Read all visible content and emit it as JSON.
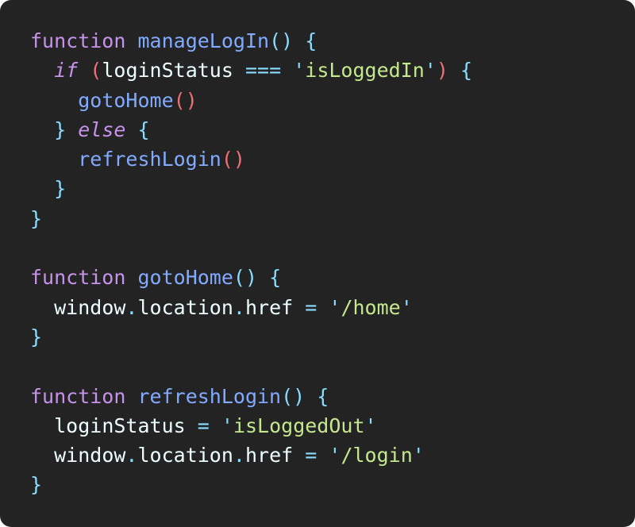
{
  "code_editor": {
    "lines": [
      [
        {
          "t": "function",
          "c": "kw"
        },
        {
          "t": " ",
          "c": "id"
        },
        {
          "t": "manageLogIn",
          "c": "fn"
        },
        {
          "t": "()",
          "c": "br"
        },
        {
          "t": " ",
          "c": "id"
        },
        {
          "t": "{",
          "c": "br"
        }
      ],
      [
        {
          "t": "  ",
          "c": "id"
        },
        {
          "t": "if",
          "c": "kw ital"
        },
        {
          "t": " ",
          "c": "id"
        },
        {
          "t": "(",
          "c": "pr"
        },
        {
          "t": "loginStatus",
          "c": "id"
        },
        {
          "t": " ",
          "c": "id"
        },
        {
          "t": "===",
          "c": "op"
        },
        {
          "t": " ",
          "c": "id"
        },
        {
          "t": "'",
          "c": "br"
        },
        {
          "t": "isLoggedIn",
          "c": "str"
        },
        {
          "t": "'",
          "c": "br"
        },
        {
          "t": ")",
          "c": "pr"
        },
        {
          "t": " ",
          "c": "id"
        },
        {
          "t": "{",
          "c": "br"
        }
      ],
      [
        {
          "t": "    ",
          "c": "id"
        },
        {
          "t": "gotoHome",
          "c": "fn"
        },
        {
          "t": "()",
          "c": "pr"
        }
      ],
      [
        {
          "t": "  ",
          "c": "id"
        },
        {
          "t": "}",
          "c": "br"
        },
        {
          "t": " ",
          "c": "id"
        },
        {
          "t": "else",
          "c": "kw ital"
        },
        {
          "t": " ",
          "c": "id"
        },
        {
          "t": "{",
          "c": "br"
        }
      ],
      [
        {
          "t": "    ",
          "c": "id"
        },
        {
          "t": "refreshLogin",
          "c": "fn"
        },
        {
          "t": "()",
          "c": "pr"
        }
      ],
      [
        {
          "t": "  ",
          "c": "id"
        },
        {
          "t": "}",
          "c": "br"
        }
      ],
      [
        {
          "t": "}",
          "c": "br"
        }
      ],
      [],
      [
        {
          "t": "function",
          "c": "kw"
        },
        {
          "t": " ",
          "c": "id"
        },
        {
          "t": "gotoHome",
          "c": "fn"
        },
        {
          "t": "()",
          "c": "br"
        },
        {
          "t": " ",
          "c": "id"
        },
        {
          "t": "{",
          "c": "br"
        }
      ],
      [
        {
          "t": "  ",
          "c": "id"
        },
        {
          "t": "window",
          "c": "id"
        },
        {
          "t": ".",
          "c": "op"
        },
        {
          "t": "location",
          "c": "id"
        },
        {
          "t": ".",
          "c": "op"
        },
        {
          "t": "href",
          "c": "id"
        },
        {
          "t": " ",
          "c": "id"
        },
        {
          "t": "=",
          "c": "op"
        },
        {
          "t": " ",
          "c": "id"
        },
        {
          "t": "'",
          "c": "br"
        },
        {
          "t": "/home",
          "c": "str"
        },
        {
          "t": "'",
          "c": "br"
        }
      ],
      [
        {
          "t": "}",
          "c": "br"
        }
      ],
      [],
      [
        {
          "t": "function",
          "c": "kw"
        },
        {
          "t": " ",
          "c": "id"
        },
        {
          "t": "refreshLogin",
          "c": "fn"
        },
        {
          "t": "()",
          "c": "br"
        },
        {
          "t": " ",
          "c": "id"
        },
        {
          "t": "{",
          "c": "br"
        }
      ],
      [
        {
          "t": "  ",
          "c": "id"
        },
        {
          "t": "loginStatus",
          "c": "id"
        },
        {
          "t": " ",
          "c": "id"
        },
        {
          "t": "=",
          "c": "op"
        },
        {
          "t": " ",
          "c": "id"
        },
        {
          "t": "'",
          "c": "br"
        },
        {
          "t": "isLoggedOut",
          "c": "str"
        },
        {
          "t": "'",
          "c": "br"
        }
      ],
      [
        {
          "t": "  ",
          "c": "id"
        },
        {
          "t": "window",
          "c": "id"
        },
        {
          "t": ".",
          "c": "op"
        },
        {
          "t": "location",
          "c": "id"
        },
        {
          "t": ".",
          "c": "op"
        },
        {
          "t": "href",
          "c": "id"
        },
        {
          "t": " ",
          "c": "id"
        },
        {
          "t": "=",
          "c": "op"
        },
        {
          "t": " ",
          "c": "id"
        },
        {
          "t": "'",
          "c": "br"
        },
        {
          "t": "/login",
          "c": "str"
        },
        {
          "t": "'",
          "c": "br"
        }
      ],
      [
        {
          "t": "}",
          "c": "br"
        }
      ]
    ]
  },
  "colors": {
    "background": "#232323",
    "keyword": "#c792ea",
    "function_name": "#82aaff",
    "punctuation": "#89ddff",
    "paren_call": "#f07178",
    "string": "#c3e88d",
    "identifier": "#eeffff"
  }
}
